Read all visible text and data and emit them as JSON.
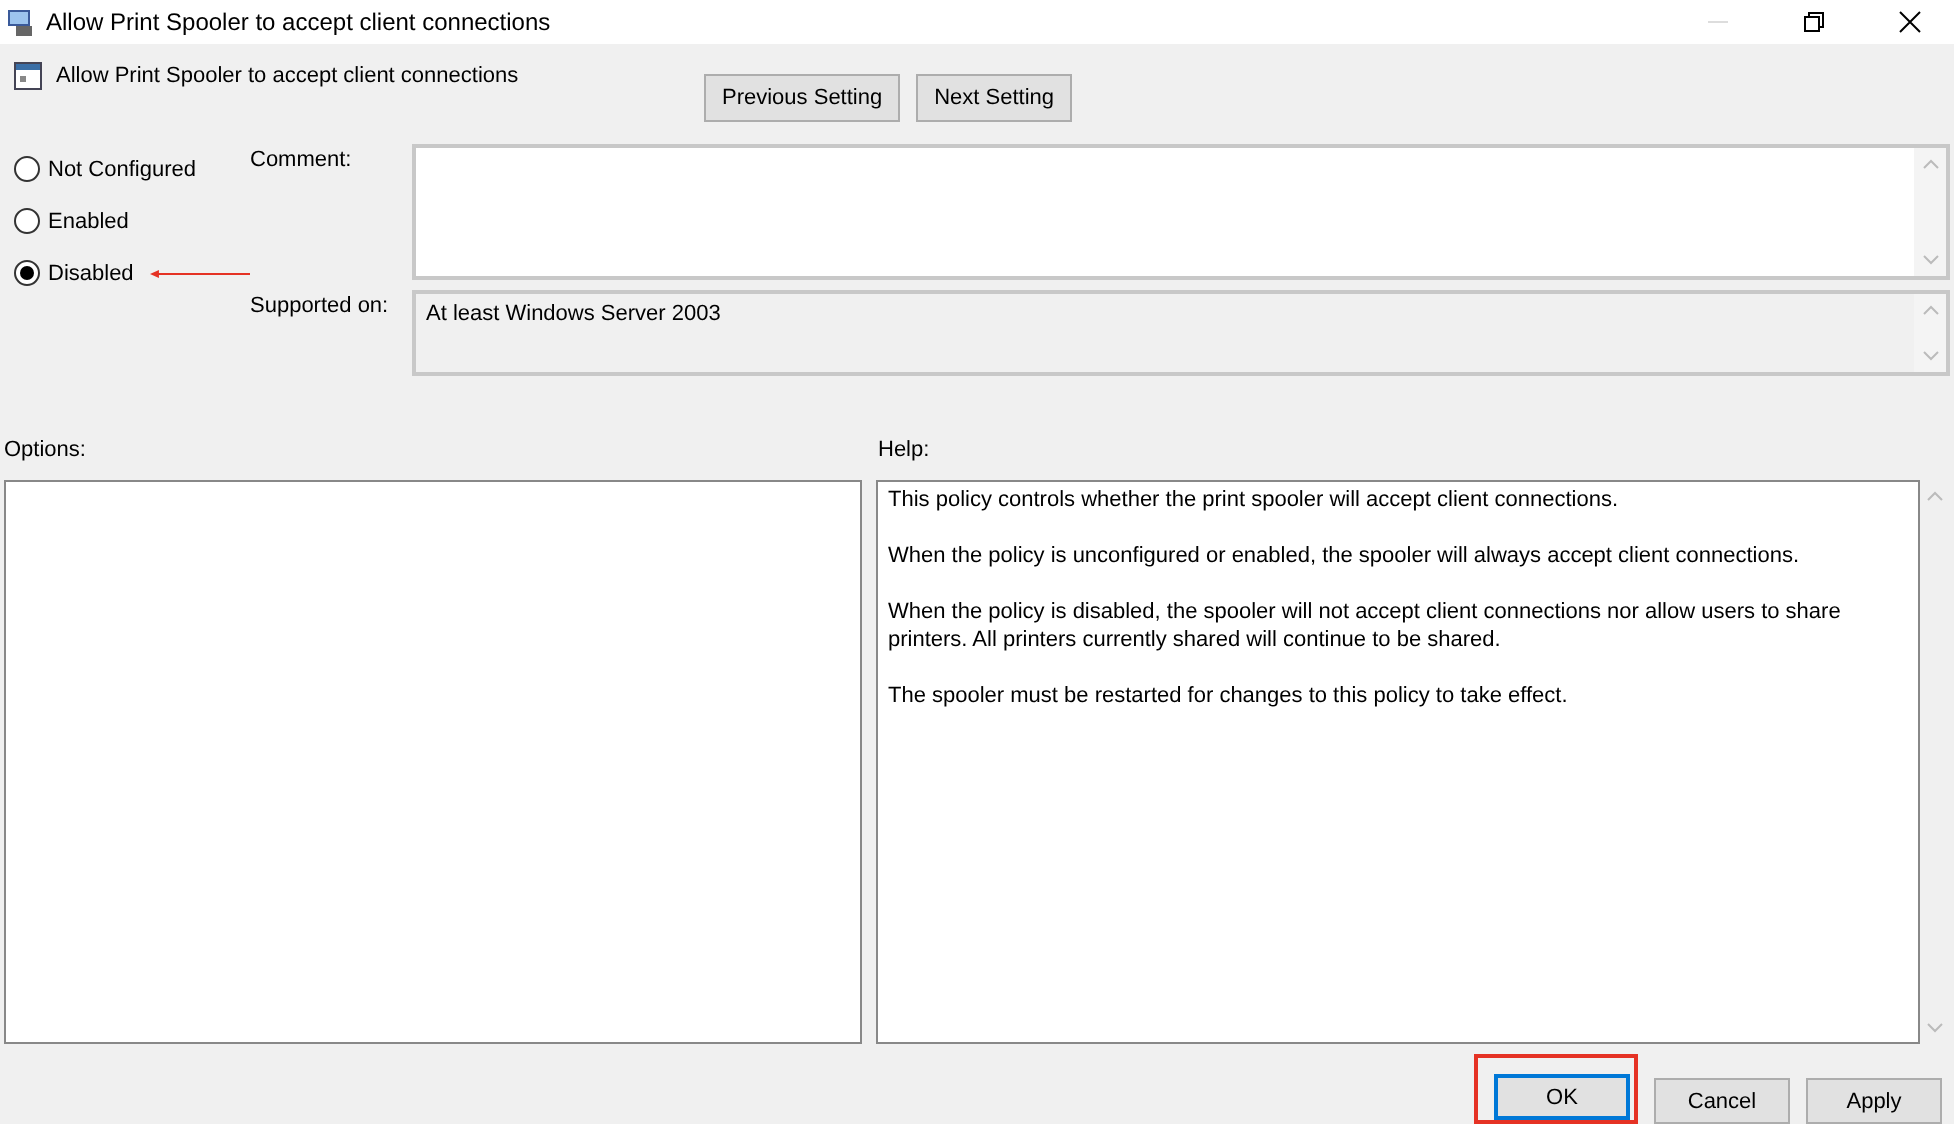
{
  "window": {
    "title": "Allow Print Spooler to accept client connections"
  },
  "header": {
    "policy_name": "Allow Print Spooler to accept client connections",
    "nav_buttons": [
      "Previous Setting",
      "Next Setting"
    ]
  },
  "options_state": [
    {
      "label": "Not Configured",
      "selected": false
    },
    {
      "label": "Enabled",
      "selected": false
    },
    {
      "label": "Disabled",
      "selected": true
    }
  ],
  "comment": {
    "label": "Comment:"
  },
  "supported_on": {
    "label": "Supported on:",
    "value": "At least Windows Server 2003"
  },
  "options": {
    "label": "Options:"
  },
  "help": {
    "label": "Help:",
    "paragraphs": [
      "This policy controls whether the print spooler will accept client connections.",
      "When the policy is unconfigured or enabled, the spooler will always accept client connections.",
      "When the policy is disabled, the spooler will not accept client connections nor allow users to share printers.  All printers currently shared will continue to be shared.",
      "The spooler must be restarted for changes to this policy to take effect."
    ]
  },
  "buttons": [
    "OK",
    "Cancel",
    "Apply"
  ]
}
